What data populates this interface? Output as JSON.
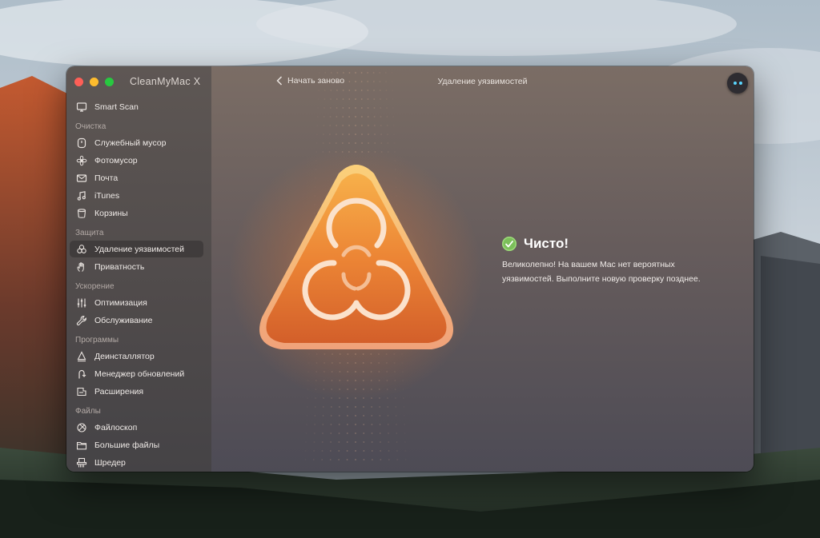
{
  "app": {
    "title": "CleanMyMac X"
  },
  "toolbar": {
    "back_label": "Начать заново",
    "page_title": "Удаление уязвимостей"
  },
  "sidebar": {
    "top_item": {
      "label": "Smart Scan",
      "icon": "monitor-icon"
    },
    "sections": [
      {
        "label": "Очистка",
        "items": [
          {
            "label": "Служебный мусор",
            "icon": "disk-icon"
          },
          {
            "label": "Фотомусор",
            "icon": "flower-icon"
          },
          {
            "label": "Почта",
            "icon": "mail-icon"
          },
          {
            "label": "iTunes",
            "icon": "music-note-icon"
          },
          {
            "label": "Корзины",
            "icon": "trash-bin-icon"
          }
        ]
      },
      {
        "label": "Защита",
        "items": [
          {
            "label": "Удаление уязвимостей",
            "icon": "biohazard-icon",
            "active": true
          },
          {
            "label": "Приватность",
            "icon": "hand-icon"
          }
        ]
      },
      {
        "label": "Ускорение",
        "items": [
          {
            "label": "Оптимизация",
            "icon": "sliders-icon"
          },
          {
            "label": "Обслуживание",
            "icon": "wrench-icon"
          }
        ]
      },
      {
        "label": "Программы",
        "items": [
          {
            "label": "Деинсталлятор",
            "icon": "uninstaller-icon"
          },
          {
            "label": "Менеджер обновлений",
            "icon": "updater-icon"
          },
          {
            "label": "Расширения",
            "icon": "extensions-icon"
          }
        ]
      },
      {
        "label": "Файлы",
        "items": [
          {
            "label": "Файлоскоп",
            "icon": "lens-icon"
          },
          {
            "label": "Большие файлы",
            "icon": "folder-icon"
          },
          {
            "label": "Шредер",
            "icon": "shredder-icon"
          }
        ]
      }
    ]
  },
  "result": {
    "status": "Чисто!",
    "message": "Великолепно! На вашем Mac нет вероятных уязвимостей. Выполните новую проверку позднее."
  },
  "colors": {
    "accent_orange": "#ee8a3c",
    "success_green": "#7bbf5a",
    "assistant_dot": "#5ad7ff"
  }
}
